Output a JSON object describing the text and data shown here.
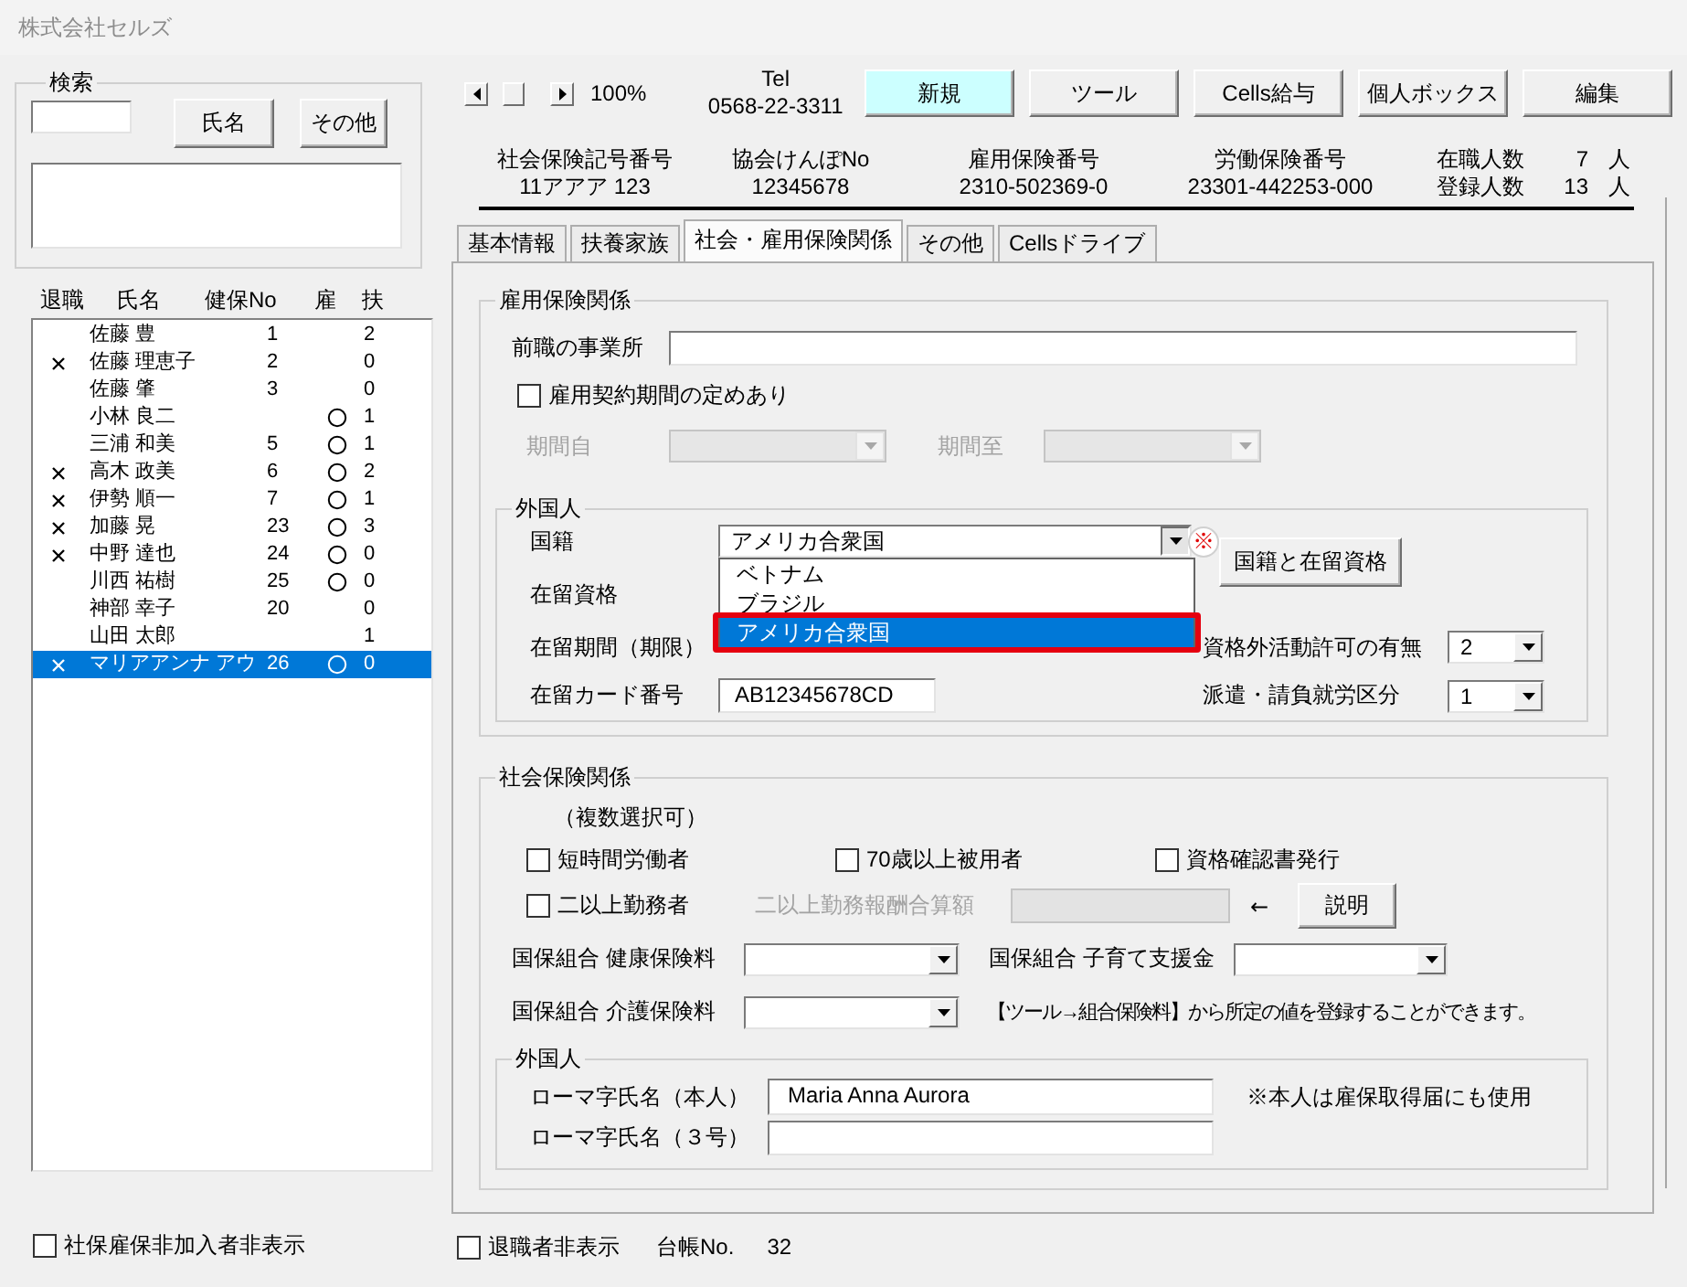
{
  "window": {
    "title": "株式会社セルズ"
  },
  "search": {
    "title": "検索",
    "buttons": [
      "氏名",
      "その他"
    ]
  },
  "employee_list": {
    "columns": [
      "退職",
      "氏名",
      "健保No",
      "雇",
      "扶"
    ],
    "rows": [
      {
        "retired": false,
        "name": "佐藤 豊",
        "health_no": "1",
        "employment_insurance": false,
        "dependents": "2",
        "selected": false
      },
      {
        "retired": true,
        "name": "佐藤 理恵子",
        "health_no": "2",
        "employment_insurance": false,
        "dependents": "0",
        "selected": false
      },
      {
        "retired": false,
        "name": "佐藤 肇",
        "health_no": "3",
        "employment_insurance": false,
        "dependents": "0",
        "selected": false
      },
      {
        "retired": false,
        "name": "小林 良二",
        "employment_insurance": true,
        "dependents": "1",
        "selected": false
      },
      {
        "retired": false,
        "name": "三浦 和美",
        "health_no": "5",
        "employment_insurance": true,
        "dependents": "1",
        "selected": false
      },
      {
        "retired": true,
        "name": "高木 政美",
        "health_no": "6",
        "employment_insurance": true,
        "dependents": "2",
        "selected": false
      },
      {
        "retired": true,
        "name": "伊勢 順一",
        "health_no": "7",
        "employment_insurance": true,
        "dependents": "1",
        "selected": false
      },
      {
        "retired": true,
        "name": "加藤 晃",
        "health_no": "23",
        "employment_insurance": true,
        "dependents": "3",
        "selected": false
      },
      {
        "retired": true,
        "name": "中野 達也",
        "health_no": "24",
        "employment_insurance": true,
        "dependents": "0",
        "selected": false
      },
      {
        "retired": false,
        "name": "川西 祐樹",
        "health_no": "25",
        "employment_insurance": true,
        "dependents": "0",
        "selected": false
      },
      {
        "retired": false,
        "name": "神部 幸子",
        "health_no": "20",
        "employment_insurance": false,
        "dependents": "0",
        "selected": false
      },
      {
        "retired": false,
        "name": "山田 太郎",
        "employment_insurance": false,
        "dependents": "1",
        "selected": false
      },
      {
        "retired": true,
        "name": "マリアアンナ アウ",
        "health_no": "26",
        "employment_insurance": true,
        "dependents": "0",
        "selected": true
      }
    ]
  },
  "hide_uninsured": {
    "label": "社保雇保非加入者非表示",
    "checked": false
  },
  "toolbar": {
    "zoom": "100%",
    "tel_label": "Tel",
    "tel": "0568-22-3311",
    "buttons": [
      {
        "label": "新規",
        "highlighted": true
      },
      {
        "label": "ツール",
        "highlighted": false
      },
      {
        "label": "Cells給与",
        "highlighted": false
      },
      {
        "label": "個人ボックス",
        "highlighted": false
      },
      {
        "label": "編集",
        "highlighted": false
      }
    ]
  },
  "insurance_numbers": [
    {
      "label": "社会保険記号番号",
      "value": "11アアア 123"
    },
    {
      "label": "協会けんぽNo",
      "value": "12345678"
    },
    {
      "label": "雇用保険番号",
      "value": "2310-502369-0"
    },
    {
      "label": "労働保険番号",
      "value": "23301-442253-000"
    }
  ],
  "headcounts": [
    {
      "label": "在職人数",
      "value": "7",
      "unit": "人"
    },
    {
      "label": "登録人数",
      "value": "13",
      "unit": "人"
    }
  ],
  "tabs": [
    {
      "label": "基本情報",
      "selected": false
    },
    {
      "label": "扶養家族",
      "selected": false
    },
    {
      "label": "社会・雇用保険関係",
      "selected": true
    },
    {
      "label": "その他",
      "selected": false
    },
    {
      "label": "Cellsドライブ",
      "selected": false
    }
  ],
  "employment_insurance": {
    "title": "雇用保険関係",
    "previous_employer": {
      "label": "前職の事業所"
    },
    "fixed_term": {
      "label": "雇用契約期間の定めあり",
      "checked": false
    },
    "period_from": {
      "label": "期間自",
      "disabled": true
    },
    "period_to": {
      "label": "期間至",
      "disabled": true
    },
    "foreigner": {
      "title": "外国人",
      "nationality": {
        "label": "国籍",
        "value": "アメリカ合衆国",
        "expanded": true,
        "options": [
          {
            "label": "ベトナム",
            "selected": false,
            "highlighted": false
          },
          {
            "label": "ブラジル",
            "selected": false,
            "highlighted": false
          },
          {
            "label": "アメリカ合衆国",
            "selected": true,
            "highlighted": true
          }
        ]
      },
      "note_mark": "※",
      "nationality_button": "国籍と在留資格",
      "status_label": "在留資格",
      "period_label": "在留期間（期限）",
      "work_permit": {
        "label": "資格外活動許可の有無",
        "value": "2"
      },
      "card": {
        "label": "在留カード番号",
        "value": "AB12345678CD"
      },
      "dispatch": {
        "label": "派遣・請負就労区分",
        "value": "1"
      }
    }
  },
  "social_insurance": {
    "title": "社会保険関係",
    "hint": "（複数選択可）",
    "checkboxes": [
      {
        "label": "短時間労働者",
        "checked": false
      },
      {
        "label": "70歳以上被用者",
        "checked": false
      },
      {
        "label": "資格確認書発行",
        "checked": false
      },
      {
        "label": "二以上勤務者",
        "checked": false
      }
    ],
    "combined_pay": {
      "label": "二以上勤務報酬合算額",
      "disabled": true
    },
    "arrow": "←",
    "explain_button": "説明",
    "union_fees": [
      {
        "label": "国保組合 健康保険料"
      },
      {
        "label": "国保組合 子育て支援金"
      },
      {
        "label": "国保組合 介護保険料"
      }
    ],
    "union_note": "【ツール→組合保険料】から所定の値を登録することができます。",
    "foreigner": {
      "title": "外国人",
      "names": [
        {
          "label": "ローマ字氏名（本人）",
          "value": "Maria Anna Aurora"
        },
        {
          "label": "ローマ字氏名（３号）"
        }
      ],
      "note": "※本人は雇保取得届にも使用"
    }
  },
  "footer": {
    "hide_retired": {
      "label": "退職者非表示",
      "checked": false
    },
    "ledger_label": "台帳No.",
    "ledger_no": "32"
  }
}
